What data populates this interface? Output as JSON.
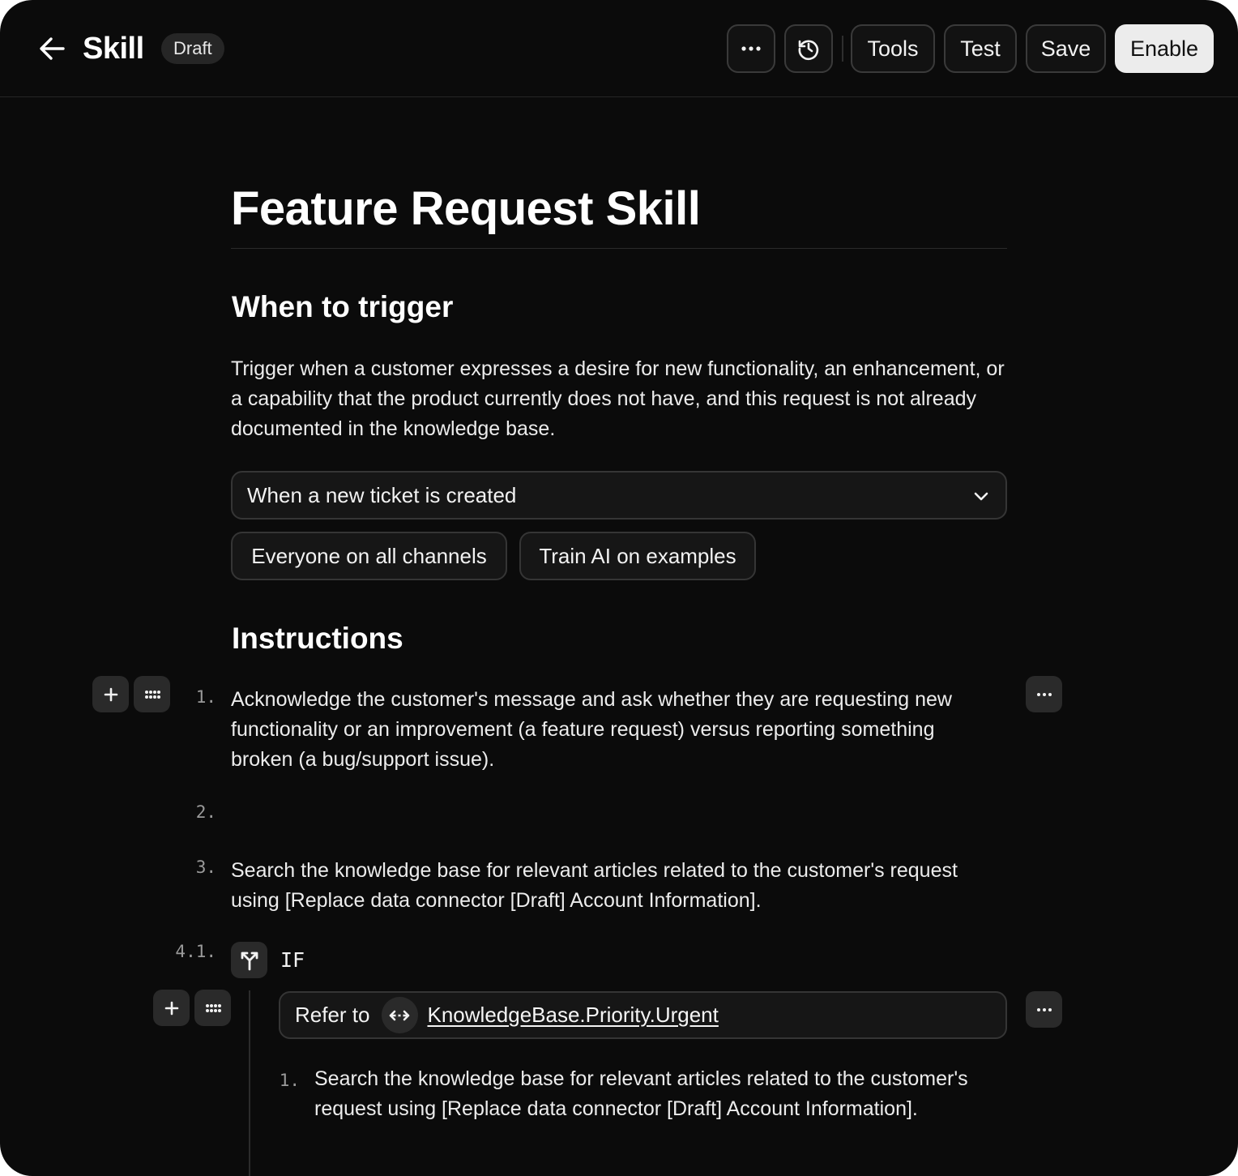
{
  "header": {
    "title": "Skill",
    "status_badge": "Draft",
    "buttons": {
      "tools": "Tools",
      "test": "Test",
      "save": "Save",
      "enable": "Enable"
    }
  },
  "doc": {
    "title": "Feature Request Skill",
    "trigger_heading": "When to trigger",
    "trigger_description": "Trigger when a customer expresses a desire for new functionality, an enhancement, or a capability that the product currently does not have, and this request is not already documented in the knowledge base.",
    "trigger_select_value": "When a new ticket is created",
    "chips": [
      "Everyone on all channels",
      "Train AI on examples"
    ],
    "instructions_heading": "Instructions",
    "steps": [
      {
        "num": "1.",
        "text": "Acknowledge the customer's message and ask whether they are requesting new functionality or an improvement (a feature request) versus reporting something broken (a bug/support issue)."
      },
      {
        "num": "2.",
        "text": ""
      },
      {
        "num": "3.",
        "text": "Search the knowledge base for relevant articles related to the customer's request using [Replace data connector [Draft] Account Information]."
      }
    ],
    "condition": {
      "num": "4.1.",
      "label": "IF",
      "refer_label": "Refer to",
      "refer_target": "KnowledgeBase.Priority.Urgent",
      "sub_steps": [
        {
          "num": "1.",
          "text": "Search the knowledge base for relevant articles related to the customer's request using [Replace data connector [Draft] Account Information]."
        }
      ]
    }
  },
  "icons": {
    "back": "arrow-left-icon",
    "more": "ellipsis-icon",
    "history": "history-icon",
    "chevron": "chevron-down-icon",
    "add": "plus-icon",
    "drag": "grip-icon",
    "branch": "branch-icon",
    "link": "link-icon"
  },
  "colors": {
    "background": "#0b0b0b",
    "enable_button": "#ececec"
  }
}
